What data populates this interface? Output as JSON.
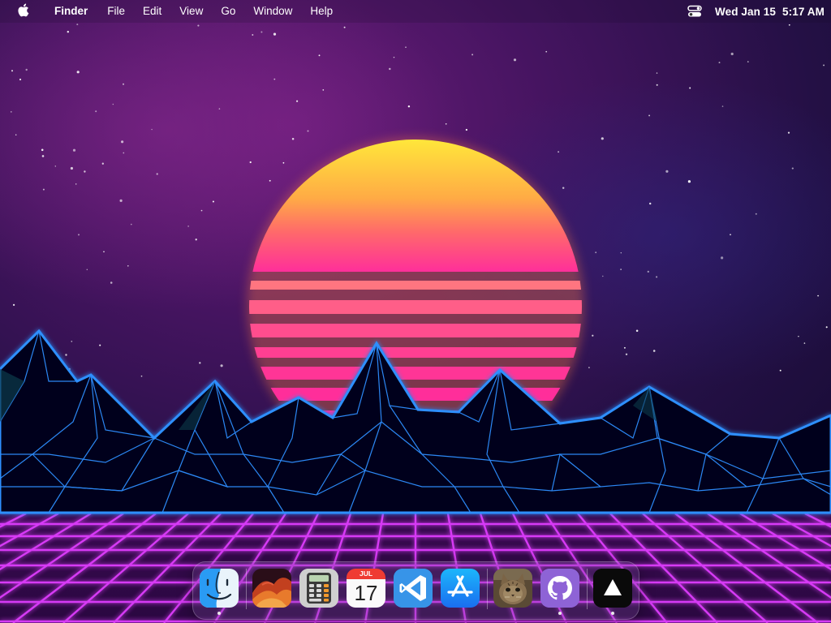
{
  "menubar": {
    "apple_icon": "apple-logo-icon",
    "app_name": "Finder",
    "menus": [
      "File",
      "Edit",
      "View",
      "Go",
      "Window",
      "Help"
    ],
    "control_center_icon": "control-center-icon",
    "date": "Wed Jan 15",
    "time": "5:17 AM"
  },
  "wallpaper": {
    "description_icon": "synthwave-wallpaper",
    "sky_colors": [
      "#2a0a48",
      "#5a1466",
      "#1a0b38"
    ],
    "sun_colors": [
      "#ffe23a",
      "#ff8a50",
      "#ff2f8c"
    ],
    "mountain_line_color": "#2f8fff",
    "grid_line_color": "#e040ff"
  },
  "dock": {
    "apps": [
      {
        "name": "Finder",
        "icon": "finder-icon",
        "running": true
      },
      {
        "name": "macOS Monterey",
        "icon": "monterey-icon",
        "running": false
      },
      {
        "name": "Calculator",
        "icon": "calculator-icon",
        "running": false
      },
      {
        "name": "Calendar",
        "icon": "calendar-icon",
        "running": false,
        "month": "JUL",
        "day": "17"
      },
      {
        "name": "Visual Studio Code",
        "icon": "vscode-icon",
        "running": false
      },
      {
        "name": "App Store",
        "icon": "app-store-icon",
        "running": false
      },
      {
        "name": "Cat",
        "icon": "cat-photo-icon",
        "running": false
      },
      {
        "name": "GitHub",
        "icon": "github-icon",
        "running": true
      },
      {
        "name": "Vercel",
        "icon": "vercel-icon",
        "running": true
      }
    ]
  }
}
